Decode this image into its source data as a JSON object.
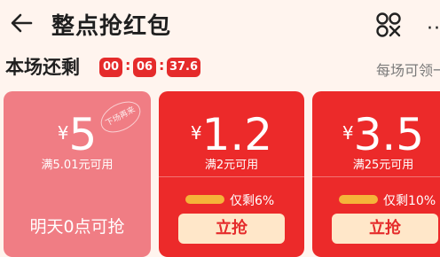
{
  "header": {
    "title": "整点抢红包",
    "more_label": "··"
  },
  "timer": {
    "label": "本场还剩",
    "hours": "00",
    "minutes": "06",
    "seconds": "37.6",
    "notice": "每场可领一"
  },
  "coupons": [
    {
      "currency": "¥",
      "amount": "5",
      "condition": "满5.01元可用",
      "stamp": "下场再来",
      "note": "明天0点可抢"
    },
    {
      "currency": "¥",
      "amount": "1.2",
      "condition": "满2元可用",
      "remaining_text": "仅剩6%",
      "button_label": "立抢"
    },
    {
      "currency": "¥",
      "amount": "3.5",
      "condition": "满25元可用",
      "remaining_text": "仅剩10%",
      "button_label": "立抢"
    }
  ],
  "colors": {
    "accent_red": "#e52b2b",
    "card_red": "#ec2a2a",
    "card_pink": "#f07d84",
    "button_bg": "#ffe7c9",
    "progress": "#f5b43a",
    "page_bg": "#fff4ee"
  }
}
